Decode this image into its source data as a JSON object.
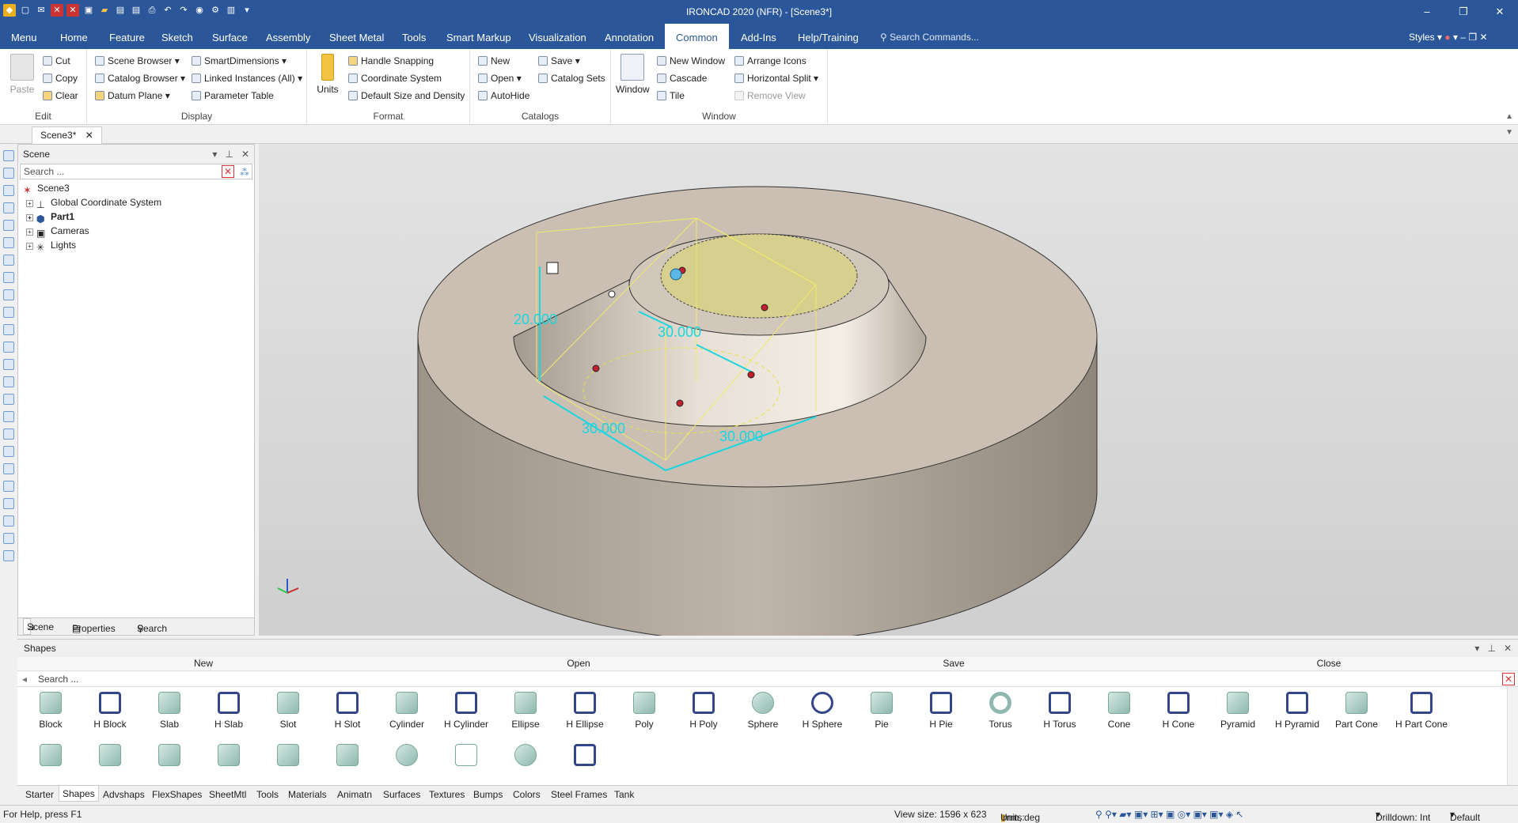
{
  "app": {
    "title": "IRONCAD 2020 (NFR) - [Scene3*]"
  },
  "menu_tabs": [
    "Menu",
    "Home",
    "Feature",
    "Sketch",
    "Surface",
    "Assembly",
    "Sheet Metal",
    "Tools",
    "Smart Markup",
    "Visualization",
    "Annotation",
    "Common",
    "Add-Ins",
    "Help/Training"
  ],
  "active_tab": "Common",
  "search_commands": "Search Commands...",
  "styles_label": "Styles",
  "ribbon": {
    "edit": {
      "label": "Edit",
      "paste": "Paste",
      "cut": "Cut",
      "copy": "Copy",
      "clear": "Clear"
    },
    "display": {
      "label": "Display",
      "scene_browser": "Scene Browser",
      "catalog_browser": "Catalog Browser",
      "datum_plane": "Datum Plane",
      "smart_dimensions": "SmartDimensions",
      "linked_instances": "Linked Instances (All)",
      "parameter_table": "Parameter Table"
    },
    "format": {
      "label": "Format",
      "units": "Units",
      "handle_snapping": "Handle Snapping",
      "coordinate_system": "Coordinate System",
      "default_size": "Default Size and Density"
    },
    "catalogs": {
      "label": "Catalogs",
      "new": "New",
      "open": "Open",
      "autohide": "AutoHide",
      "save": "Save",
      "catalog_sets": "Catalog Sets"
    },
    "window": {
      "label": "Window",
      "window": "Window",
      "new_window": "New Window",
      "cascade": "Cascade",
      "tile": "Tile",
      "arrange_icons": "Arrange Icons",
      "horizontal_split": "Horizontal Split",
      "remove_view": "Remove View"
    }
  },
  "document_tab": "Scene3*",
  "scene_panel": {
    "title": "Scene",
    "search_placeholder": "Search ...",
    "tree": [
      {
        "label": "Scene3",
        "bold": false
      },
      {
        "label": "Global Coordinate System",
        "bold": false
      },
      {
        "label": "Part1",
        "bold": true
      },
      {
        "label": "Cameras",
        "bold": false
      },
      {
        "label": "Lights",
        "bold": false
      }
    ],
    "tabs": [
      "Scene",
      "Properties",
      "Search"
    ]
  },
  "viewport": {
    "dim_height": "20.000",
    "dim_top": "30.000",
    "dim_left": "30.000",
    "dim_right": "30.000"
  },
  "shapes_panel": {
    "title": "Shapes",
    "bar": [
      "New",
      "Open",
      "Save",
      "Close"
    ],
    "search_placeholder": "Search ...",
    "row1": [
      "Block",
      "H Block",
      "Slab",
      "H Slab",
      "Slot",
      "H Slot",
      "Cylinder",
      "H Cylinder",
      "Ellipse",
      "H Ellipse",
      "Poly",
      "H Poly",
      "Sphere",
      "H Sphere",
      "Pie",
      "H Pie",
      "Torus",
      "H Torus",
      "Cone",
      "H Cone",
      "Pyramid",
      "H Pyramid",
      "Part Cone",
      "H Part Cone"
    ],
    "tabs": [
      "Starter",
      "Shapes",
      "Advshaps",
      "FlexShapes",
      "SheetMtl",
      "Tools",
      "Materials",
      "Animatn",
      "Surfaces",
      "Textures",
      "Bumps",
      "Colors",
      "Steel Frames",
      "Tank"
    ],
    "active_tab": "Shapes"
  },
  "status": {
    "help": "For Help, press F1",
    "view_size": "View size: 1596 x 623",
    "units_label": "Units:",
    "units_value": "mm, deg",
    "drilldown": "Drilldown: Int",
    "default": "Default"
  }
}
